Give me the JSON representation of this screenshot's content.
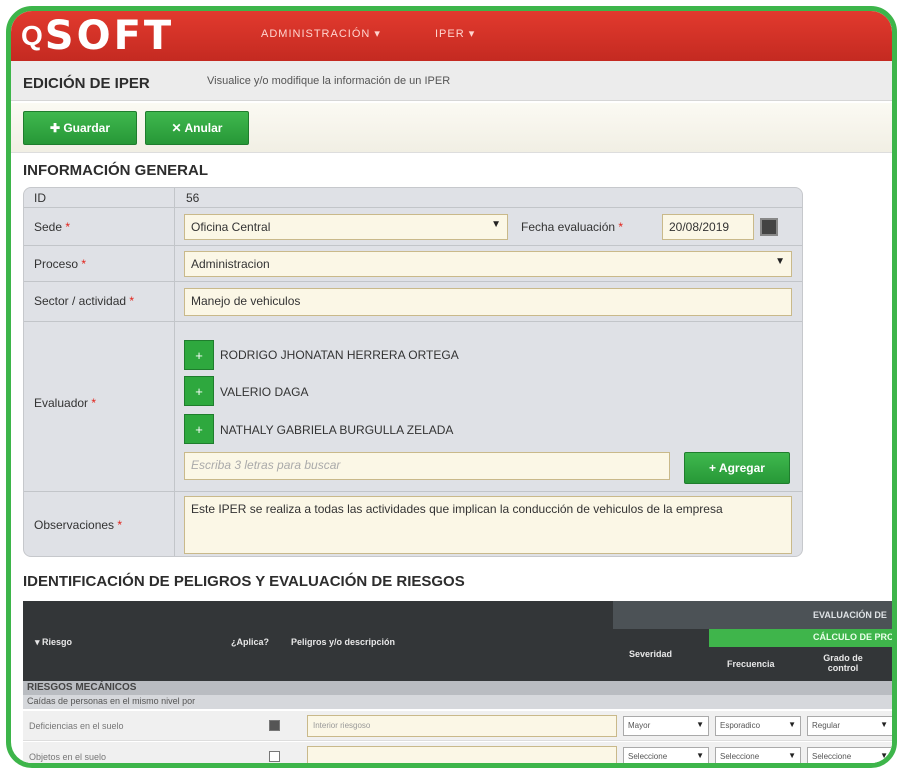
{
  "app": {
    "logo_q": "Q",
    "logo_text": "SOFT",
    "menu": [
      "ADMINISTRACIÓN ▾",
      "IPER ▾"
    ]
  },
  "page": {
    "title": "EDICIÓN DE IPER",
    "subtitle": "Visualice y/o modifique la información de un IPER"
  },
  "toolbar": {
    "save_label": "✚ Guardar",
    "cancel_label": "✕ Anular"
  },
  "general": {
    "section_title": "INFORMACIÓN GENERAL",
    "id_label": "ID",
    "id_value": "56",
    "sede_label": "Sede",
    "sede_value": "Oficina Central",
    "fecha_label": "Fecha evaluación",
    "fecha_value": "20/08/2019",
    "proceso_label": "Proceso",
    "proceso_value": "Administracion",
    "sector_label": "Sector / actividad",
    "sector_value": "Manejo de vehiculos",
    "evaluador_label": "Evaluador",
    "evaluadores": [
      "RODRIGO JHONATAN HERRERA ORTEGA",
      "VALERIO DAGA",
      "NATHALY GABRIELA BURGULLA ZELADA"
    ],
    "search_placeholder": "Escriba 3 letras para buscar",
    "add_label": "+ Agregar",
    "obs_label": "Observaciones",
    "obs_value": "Este IPER se realiza a todas las actividades que implican la conducción de vehiculos de la empresa"
  },
  "grid": {
    "section_title": "IDENTIFICACIÓN DE PELIGROS Y EVALUACIÓN DE RIESGOS",
    "headers": {
      "riesgo": "▾ Riesgo",
      "aplica": "¿Aplica?",
      "peligro": "Peligros y/o descripción",
      "severidad": "Severidad",
      "frecuencia": "Frecuencia",
      "grado": "Grado de control",
      "evaluacion": "EVALUACIÓN DE",
      "calculo": "CÁLCULO DE PRO"
    },
    "group": "RIESGOS MECÁNICOS",
    "subgroup": "Caídas de personas en el mismo nivel por",
    "rows": [
      {
        "risk": "Deficiencias en el suelo",
        "input": "Interior riesgoso",
        "sev": "Mayor",
        "freq": "Esporadico",
        "grado": "Regular"
      },
      {
        "risk": "Objetos en el suelo",
        "input": "",
        "sev": "Seleccione",
        "freq": "Seleccione",
        "grado": "Seleccione"
      }
    ]
  }
}
